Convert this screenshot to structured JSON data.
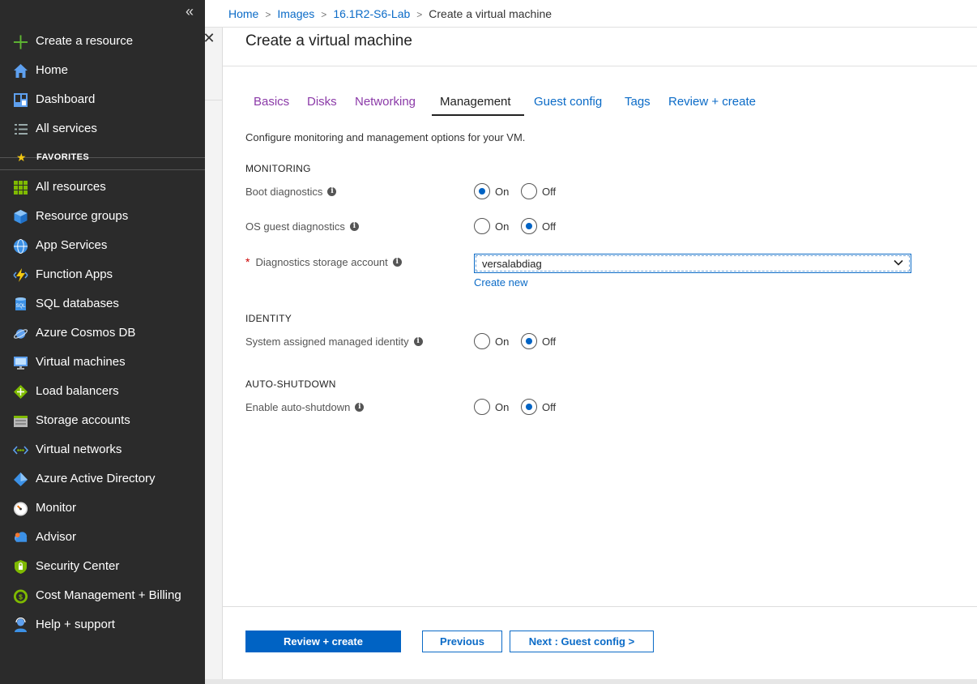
{
  "sidebar": {
    "collapse": "«",
    "top_items": [
      {
        "label": "Create a resource",
        "icon": "plus-icon"
      },
      {
        "label": "Home",
        "icon": "home-icon"
      },
      {
        "label": "Dashboard",
        "icon": "dashboard-icon"
      },
      {
        "label": "All services",
        "icon": "list-icon"
      }
    ],
    "favorites_label": "FAVORITES",
    "favorites": [
      {
        "label": "All resources",
        "icon": "grid-icon"
      },
      {
        "label": "Resource groups",
        "icon": "cube-icon"
      },
      {
        "label": "App Services",
        "icon": "globe-icon"
      },
      {
        "label": "Function Apps",
        "icon": "lightning-icon"
      },
      {
        "label": "SQL databases",
        "icon": "sql-icon"
      },
      {
        "label": "Azure Cosmos DB",
        "icon": "planet-icon"
      },
      {
        "label": "Virtual machines",
        "icon": "monitor-icon"
      },
      {
        "label": "Load balancers",
        "icon": "diamond-icon"
      },
      {
        "label": "Storage accounts",
        "icon": "storage-icon"
      },
      {
        "label": "Virtual networks",
        "icon": "network-icon"
      },
      {
        "label": "Azure Active Directory",
        "icon": "aad-icon"
      },
      {
        "label": "Monitor",
        "icon": "gauge-icon"
      },
      {
        "label": "Advisor",
        "icon": "cloud-icon"
      },
      {
        "label": "Security Center",
        "icon": "shield-icon"
      },
      {
        "label": "Cost Management + Billing",
        "icon": "coin-icon"
      },
      {
        "label": "Help + support",
        "icon": "person-icon"
      }
    ]
  },
  "breadcrumb": {
    "items": [
      "Home",
      "Images",
      "16.1R2-S6-Lab"
    ],
    "current": "Create a virtual machine",
    "separator": ">"
  },
  "blade": {
    "close": "✕",
    "title": "Create a virtual machine",
    "tabs": [
      "Basics",
      "Disks",
      "Networking",
      "Management",
      "Guest config",
      "Tags",
      "Review + create"
    ],
    "active_tab": "Management",
    "intro": "Configure monitoring and management options for your VM.",
    "monitoring": {
      "heading": "MONITORING",
      "boot_label": "Boot diagnostics",
      "os_label": "OS guest diagnostics",
      "storage_label": "Diagnostics storage account",
      "required_mark": "*",
      "storage_value": "versalabdiag",
      "create_new": "Create new"
    },
    "identity": {
      "heading": "IDENTITY",
      "msi_label": "System assigned managed identity"
    },
    "autoshutdown": {
      "heading": "AUTO-SHUTDOWN",
      "label": "Enable auto-shutdown"
    },
    "radio": {
      "on": "On",
      "off": "Off"
    },
    "info": "i",
    "states": {
      "boot_diagnostics": "On",
      "os_guest_diagnostics": "Off",
      "managed_identity": "Off",
      "auto_shutdown": "Off"
    },
    "footer": {
      "review": "Review + create",
      "previous": "Previous",
      "next": "Next : Guest config >"
    }
  },
  "colors": {
    "sidebar_bg": "#2b2b2b",
    "link": "#0b6bc7",
    "visited": "#8b3aa8",
    "primary_button": "#0063c4"
  }
}
